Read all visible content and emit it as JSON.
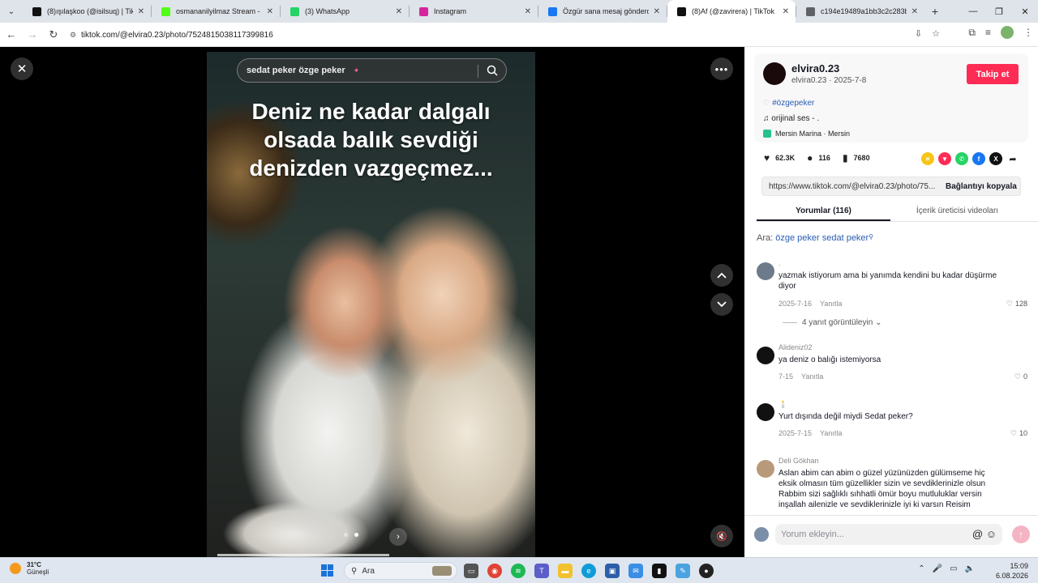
{
  "browser": {
    "tabs": [
      {
        "title": "(8)ışılaşkoo (@isilsuq) | TikTok",
        "favicon": "tiktok-icon",
        "color": "#111111"
      },
      {
        "title": "osmananilyilmaz Stream - Watc",
        "favicon": "kick-icon",
        "color": "#53fc18"
      },
      {
        "title": "(3) WhatsApp",
        "favicon": "whatsapp-icon",
        "color": "#25d366"
      },
      {
        "title": "Instagram",
        "favicon": "instagram-icon",
        "color": "#d6249f"
      },
      {
        "title": "Özgür sana mesaj gönderdi",
        "favicon": "facebook-icon",
        "color": "#1877f2"
      },
      {
        "title": "(8)Af (@zavirera) | TikTok",
        "favicon": "tiktok-icon",
        "color": "#111111",
        "active": true
      },
      {
        "title": "c194e19489a1bb3c2c283b45e",
        "favicon": "globe-icon",
        "color": "#5f6368"
      }
    ],
    "url": "tiktok.com/@elvira0.23/photo/7524815038117399816"
  },
  "viewer": {
    "search_query": "sedat peker özge peker",
    "overlay_text_lines": [
      "Deniz ne kadar dalgalı",
      "olsada balık sevdiği",
      "denizden vazgeçmez..."
    ],
    "carousel_total": 2,
    "carousel_current": 2
  },
  "panel": {
    "username": "elvira0.23",
    "subline": "elvira0.23 · 2025-7-8",
    "follow_label": "Takip et",
    "hashtag": "#özgepeker",
    "music": "orijinal ses - .",
    "location": "Mersin Marina · Mersin",
    "likes": "62.3K",
    "comments_count": "116",
    "saves": "7680",
    "link_url": "https://www.tiktok.com/@elvira0.23/photo/75...",
    "copy_label": "Bağlantıyı kopyala",
    "tab_comments": "Yorumlar (116)",
    "tab_creator": "İçerik üreticisi videoları",
    "search_prefix": "Ara:",
    "search_query": "özge peker sedat peker",
    "comments": [
      {
        "name": ".",
        "text": "yazmak istiyorum ama bi yanımda kendini bu kadar düşürme diyor",
        "date": "2025-7-16",
        "reply": "Yanıtla",
        "likes": "128",
        "replies": "4 yanıt görüntüleyin"
      },
      {
        "name": "Alideniz02",
        "text": "ya deniz o balığı istemiyorsa",
        "date": "7-15",
        "reply": "Yanıtla",
        "likes": "0"
      },
      {
        "name": "🕯️",
        "text": "Yurt dışında değil miydi Sedat peker?",
        "date": "2025-7-15",
        "reply": "Yanıtla",
        "likes": "10"
      },
      {
        "name": "Deli Gökhan",
        "text": "Aslan abim can abim o güzel yüzünüzden gülümseme hiç eksik olmasın tüm güzellikler sizin ve sevdiklerinizle olsun Rabbim sizi sağlıklı sıhhatli ömür boyu mutluluklar versin inşallah ailenizle ve sevdiklerinizle iyi ki varsın Reisim"
      }
    ],
    "composer_placeholder": "Yorum ekleyin..."
  },
  "taskbar": {
    "temperature": "31°C",
    "weather": "Güneşli",
    "search_label": "Ara",
    "time": "15:09",
    "date": "6.08.2026"
  }
}
